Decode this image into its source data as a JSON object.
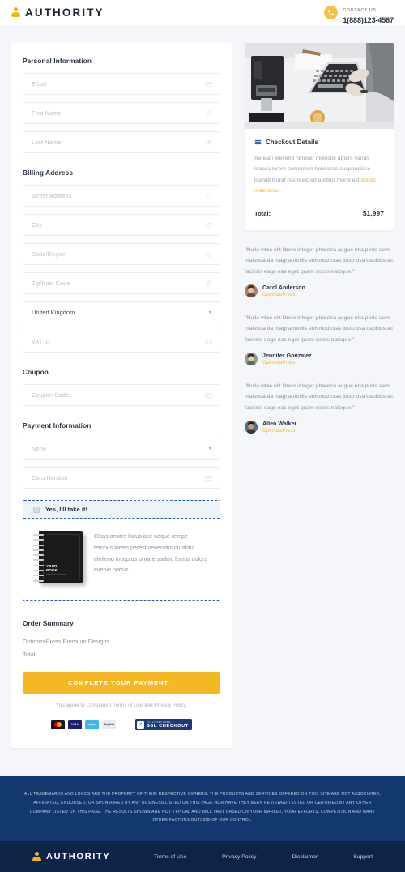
{
  "header": {
    "brand": "AUTHORITY",
    "contact_label": "CONTACT US",
    "contact_number": "1(888)123-4567"
  },
  "form": {
    "personal_title": "Personal Information",
    "personal_fields": [
      {
        "placeholder": "Email",
        "value": "",
        "icon": "mail-icon"
      },
      {
        "placeholder": "First Name",
        "value": "",
        "icon": "user-icon"
      },
      {
        "placeholder": "Last Name",
        "value": "",
        "icon": "users-icon"
      }
    ],
    "billing_title": "Billing Address",
    "billing_fields": [
      {
        "placeholder": "Street Address",
        "value": "",
        "icon": "home-icon"
      },
      {
        "placeholder": "City",
        "value": "",
        "icon": "building-icon"
      },
      {
        "placeholder": "State/Region",
        "value": "",
        "icon": "info-icon"
      },
      {
        "placeholder": "Zip/Post Code",
        "value": "",
        "icon": "pin-icon"
      }
    ],
    "country_value": "United Kingdom",
    "vat_placeholder": "VAT ID",
    "coupon_title": "Coupon",
    "coupon_placeholder": "Coupon Code",
    "payment_title": "Payment Information",
    "payment_method_value": "None",
    "card_placeholder": "Card Number"
  },
  "offer": {
    "checkbox_label": "Yes, I'll take it!",
    "book_title": "YOUR BOOK",
    "book_subtitle": "PREMIUM EDITION",
    "description": "Class ornare lacus ace neque rempe tempus lorem perest venenatis curabtur eleifend inceptos ornare sadeic lectus dolors evenie portus."
  },
  "summary": {
    "title": "Order Summary",
    "rows": [
      "OptimizePress Premium Designs",
      "Total"
    ],
    "button_label": "COMPLETE YOUR PAYMENT",
    "button_chevron": "›",
    "terms_text": "You agree to Company's Terms of Use and Privacy Policy.",
    "badges": [
      {
        "name": "mastercard-badge",
        "label": ""
      },
      {
        "name": "visa-badge",
        "label": "VISA"
      },
      {
        "name": "stripe-badge",
        "label": "stripe"
      },
      {
        "name": "paypal-badge",
        "label": "PayPal"
      }
    ],
    "ssl_line1": "FULLY SECURED",
    "ssl_line2": "SSL CHECKOUT"
  },
  "details": {
    "title": "Checkout Details",
    "body": "Aenean eleifend netuser molestie aptent varius massa lorem comentum habitasse suspendisse blandit litorat nisi nunc ed portitor morbi est ",
    "body_link": "donec maecenas.",
    "total_label": "Total:",
    "total_value": "$1,997"
  },
  "testimonials": [
    {
      "quote": "\"Nulla vitae elit libero integer pharetra augue etia porta sem malesua da magna mollis euismod cras justo osa dapibus ac facilisis eago eas eget quam sociis natoque.\"",
      "name": "Carol Anderson",
      "role": "OptimizePress"
    },
    {
      "quote": "\"Nulla vitae elit libero integer pharetra augue etia porta sem malesua da magna mollis euismod cras justo osa dapibus ac facilisis eago eas eget quam sociis natoque.\"",
      "name": "Jennifer Gonzalez",
      "role": "OptimizePress"
    },
    {
      "quote": "\"Nulla vitae elit libero integer pharetra augue etia porta sem malesua da magna mollis euismod cras justo osa dapibus ac facilisis eago eas eget quam sociis natoque.\"",
      "name": "Allen Walker",
      "role": "OptimizePress"
    }
  ],
  "footer": {
    "disclaimer": "ALL TRADEMARKS AND LOGOS ARE THE PROPERTY OF THEIR RESPECTIVE OWNERS. THE PRODUCTS AND SERVICES OFFERED ON THIS SITE ARE NOT ASSOCIATED, AFFILIATED, ENDORSED, OR SPONSORED BY ANY BUSINESS LISTED ON THIS PAGE NOR HAVE THEY BEEN REVIEWED TESTED OR CERTIFIED BY ANY OTHER COMPANY LISTED ON THIS PAGE. THE RESULTS SHOWN ARE NOT TYPICAL AND WILL VARY BASED ON YOUR MARKET, YOUR EFFORTS, COMPETITION AND MANY OTHER FACTORS OUTSIDE OF OUR CONTROL.",
    "brand": "AUTHORITY",
    "links": [
      "Terms of Use",
      "Privacy Policy",
      "Disclaimer",
      "Support"
    ]
  },
  "colors": {
    "accent": "#f4b824",
    "brand_dark": "#0c2448",
    "disclaimer_bg": "#12386f",
    "page_bg": "#f4f6f9",
    "offer_border": "#2f5fa8"
  }
}
